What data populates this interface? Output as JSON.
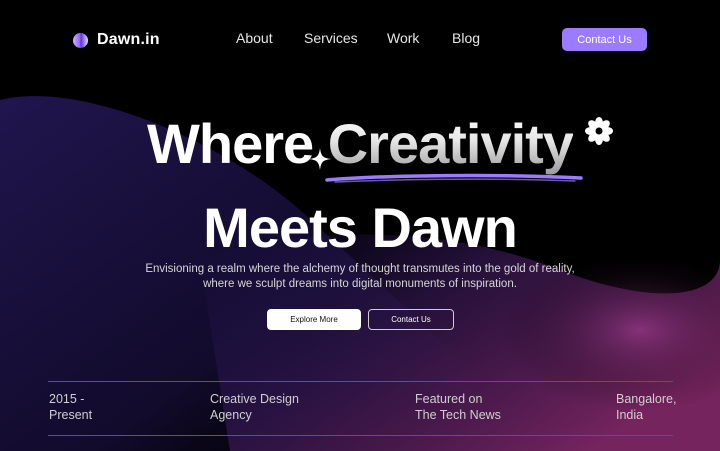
{
  "brand": {
    "name": "Dawn.in",
    "logo_icon": "half-circle-logo-icon"
  },
  "nav": {
    "links": [
      "About",
      "Services",
      "Work",
      "Blog"
    ],
    "cta": "Contact Us"
  },
  "hero": {
    "line1_plain": "Where ",
    "line1_accent": "Creativity",
    "line2": "Meets Dawn",
    "decorations": [
      "sparkle-icon",
      "flower-icon",
      "underline-stroke"
    ],
    "subtitle_line1": "Envisioning a realm where the alchemy of thought transmutes into the gold of reality,",
    "subtitle_line2": "where we sculpt dreams into digital monuments of inspiration.",
    "primary_button": "Explore More",
    "secondary_button": "Contact Us"
  },
  "info": [
    {
      "line1": "2015 -",
      "line2": "Present"
    },
    {
      "line1": "Creative Design",
      "line2": "Agency"
    },
    {
      "line1": "Featured on",
      "line2": "The Tech News"
    },
    {
      "line1": "Bangalore,",
      "line2": "India"
    }
  ],
  "colors": {
    "background": "#000000",
    "accent": "#9b7bff",
    "glow_left": "#3b2a8a",
    "glow_right": "#8a2a6e"
  }
}
